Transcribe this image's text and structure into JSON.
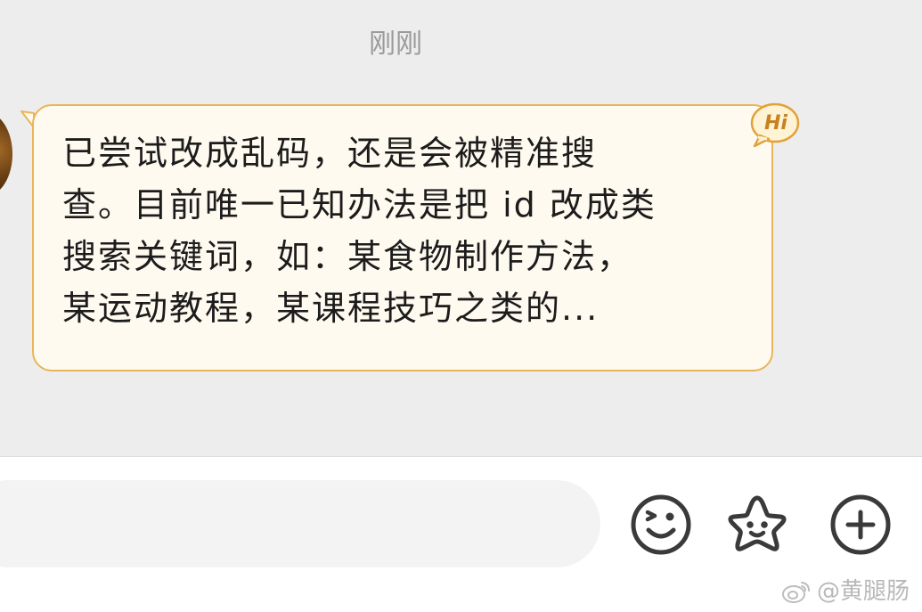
{
  "conversation": {
    "timestamp": "刚刚",
    "message": {
      "text": "已尝试改成乱码，还是会被精准搜\n查。目前唯一已知办法是把 id 改成类\n搜索关键词，如：某食物制作方法，\n某运动教程，某课程技巧之类的...",
      "badge": "Hi"
    }
  },
  "input_bar": {
    "placeholder": "",
    "value": "",
    "buttons": {
      "emoji_icon": "smile-wink-icon",
      "sticker_icon": "star-face-icon",
      "more_icon": "plus-circle-icon"
    }
  },
  "watermark": {
    "text": "@黄腿肠",
    "logo_icon": "weibo-logo-icon"
  },
  "colors": {
    "chat_background": "#ededed",
    "bubble_fill": "#fffaf0",
    "bubble_border": "#e9b55a",
    "badge": "#c7821f",
    "icon_stroke": "#3a3a3a"
  }
}
